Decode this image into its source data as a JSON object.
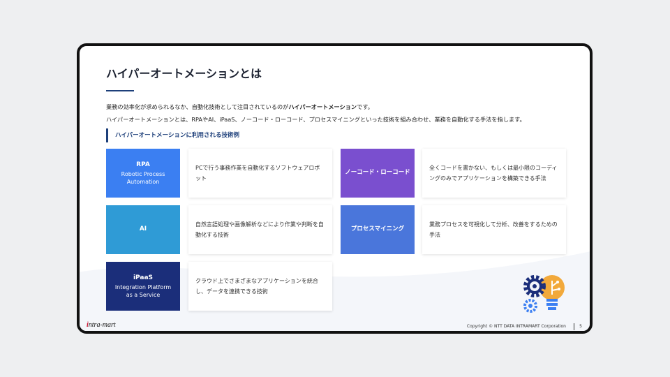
{
  "slide": {
    "title": "ハイパーオートメーションとは",
    "intro_line1_a": "業務の効率化が求められるなか、自動化技術として注目されているのが",
    "intro_line1_b": "ハイパーオートメーション",
    "intro_line1_c": "です。",
    "intro_line2": "ハイパーオートメーションとは、RPAやAI、iPaaS、ノーコード・ローコード、プロセスマイニングといった技術を組み合わせ、業務を自動化する手法を指します。",
    "subhead": "ハイパーオートメーションに利用される技術例"
  },
  "techs": [
    {
      "name": "RPA",
      "sub": "Robotic Process Automation",
      "desc": "PCで行う事務作業を自動化するソフトウェアロボット",
      "color": "#3b7ff2"
    },
    {
      "name": "AI",
      "sub": "",
      "desc": "自然言語処理や画像解析などにより作業や判断を自動化する技術",
      "color": "#2f9bd6"
    },
    {
      "name": "iPaaS",
      "sub": "Integration Platform as a Service",
      "desc": "クラウド上でさまざまなアプリケーションを統合し、データを連携できる技術",
      "color": "#1b2e7a"
    },
    {
      "name": "ノーコード・ローコード",
      "sub": "",
      "desc": "全くコードを書かない、もしくは最小限のコーディングのみでアプリケーションを構築できる手法",
      "color": "#7a4fcf"
    },
    {
      "name": "プロセスマイニング",
      "sub": "",
      "desc": "業務プロセスを可視化して分析、改善をするための手法",
      "color": "#4a76db"
    }
  ],
  "footer": {
    "logo_i": "i",
    "logo_rest": "ntra-mart",
    "copyright": "Copyright © NTT DATA INTRAMART Corporation",
    "page": "5"
  },
  "icons": {
    "illustration": "gear-lightbulb-icon"
  }
}
